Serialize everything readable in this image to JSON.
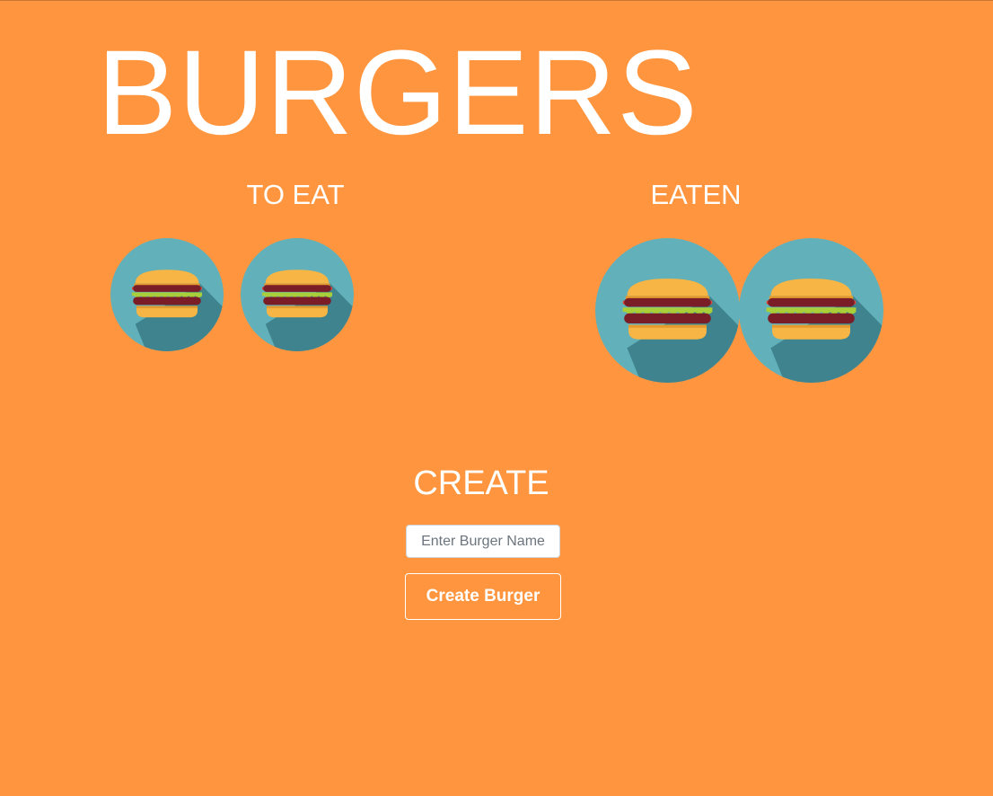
{
  "page": {
    "title": "BURGERS"
  },
  "columns": {
    "to_eat": {
      "heading": "TO EAT",
      "count": 2
    },
    "eaten": {
      "heading": "EATEN",
      "count": 2
    }
  },
  "create": {
    "heading": "CREATE",
    "input_placeholder": "Enter Burger Name",
    "input_value": "",
    "button_label": "Create Burger"
  },
  "burger_icon": "burger-icon",
  "colors": {
    "background": "#ff963f",
    "icon_circle": "#62b0ba",
    "icon_shadow": "#3f838e",
    "bun": "#f6b544",
    "patty": "#7a1d26",
    "lettuce": "#a8cf3a",
    "tomato": "#e0463a",
    "text": "#ffffff"
  }
}
